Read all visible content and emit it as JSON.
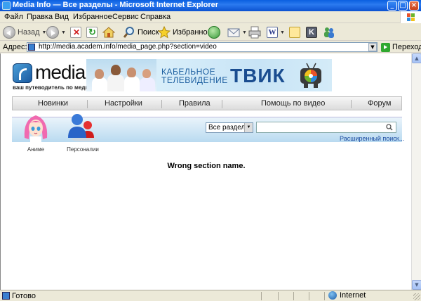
{
  "window": {
    "title": "Media Info — Все разделы - Microsoft Internet Explorer",
    "controls": [
      "_",
      "□",
      "×"
    ]
  },
  "menu": {
    "items": [
      "Файл",
      "Правка",
      "Вид",
      "Избранное",
      "Сервис",
      "Справка"
    ]
  },
  "toolbar": {
    "back_label": "Назад",
    "search_label": "Поиск",
    "favorites_label": "Избранное"
  },
  "address": {
    "label": "Адрес:",
    "url": "http://media.academ.info/media_page.php?section=video",
    "go_label": "Переход"
  },
  "site": {
    "logo_text": "media",
    "logo_tagline": "ваш путеводитель по медиа-",
    "banner": {
      "line1": "КАБЕЛЬНОЕ",
      "line2": "ТЕЛЕВИДЕНИЕ",
      "brand": "ТВИК"
    },
    "nav": [
      "Новинки",
      "Настройки",
      "Правила",
      "Помощь по видео",
      "Форум"
    ],
    "categories": [
      {
        "label": "Аниме",
        "icon": "anime-girl-icon"
      },
      {
        "label": "Персоналии",
        "icon": "people-icon"
      }
    ],
    "search": {
      "section_select": "Все разделы",
      "query": "",
      "advanced_link": "Расширенный поиск..."
    },
    "message": "Wrong section name."
  },
  "status": {
    "text": "Готово",
    "zone": "Internet"
  },
  "colors": {
    "titlebar": "#0a52d0",
    "nav_bg": "#dcdcdc",
    "catbar_bg": "#b9daf0",
    "link": "#1a4aa0"
  }
}
